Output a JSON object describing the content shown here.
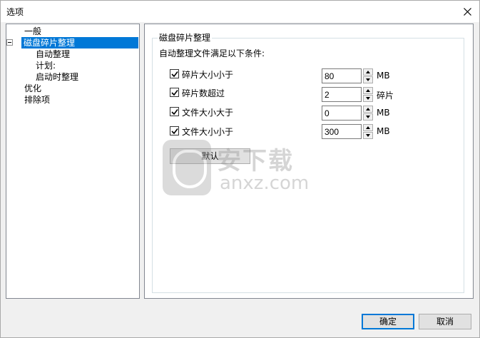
{
  "window": {
    "title": "选项"
  },
  "tree": {
    "items": [
      {
        "label": "一般"
      },
      {
        "label": "磁盘碎片整理"
      },
      {
        "label": "自动整理"
      },
      {
        "label": "计划:"
      },
      {
        "label": "启动时整理"
      },
      {
        "label": "优化"
      },
      {
        "label": "排除项"
      }
    ]
  },
  "panel": {
    "group_title": "磁盘碎片整理",
    "subtitle": "自动整理文件满足以下条件:",
    "conditions": [
      {
        "label": "碎片大小小于",
        "value": "80",
        "unit": "MB",
        "checked": true
      },
      {
        "label": "碎片数超过",
        "value": "2",
        "unit": "碎片",
        "checked": true
      },
      {
        "label": "文件大小大于",
        "value": "0",
        "unit": "MB",
        "checked": true
      },
      {
        "label": "文件大小小于",
        "value": "300",
        "unit": "MB",
        "checked": true
      }
    ],
    "default_button": "默认"
  },
  "footer": {
    "ok": "确定",
    "cancel": "取消"
  },
  "watermark": {
    "text": "安下载",
    "url": "anxz.com"
  },
  "colors": {
    "selection": "#0078d7",
    "primary_border": "#0078d7"
  }
}
